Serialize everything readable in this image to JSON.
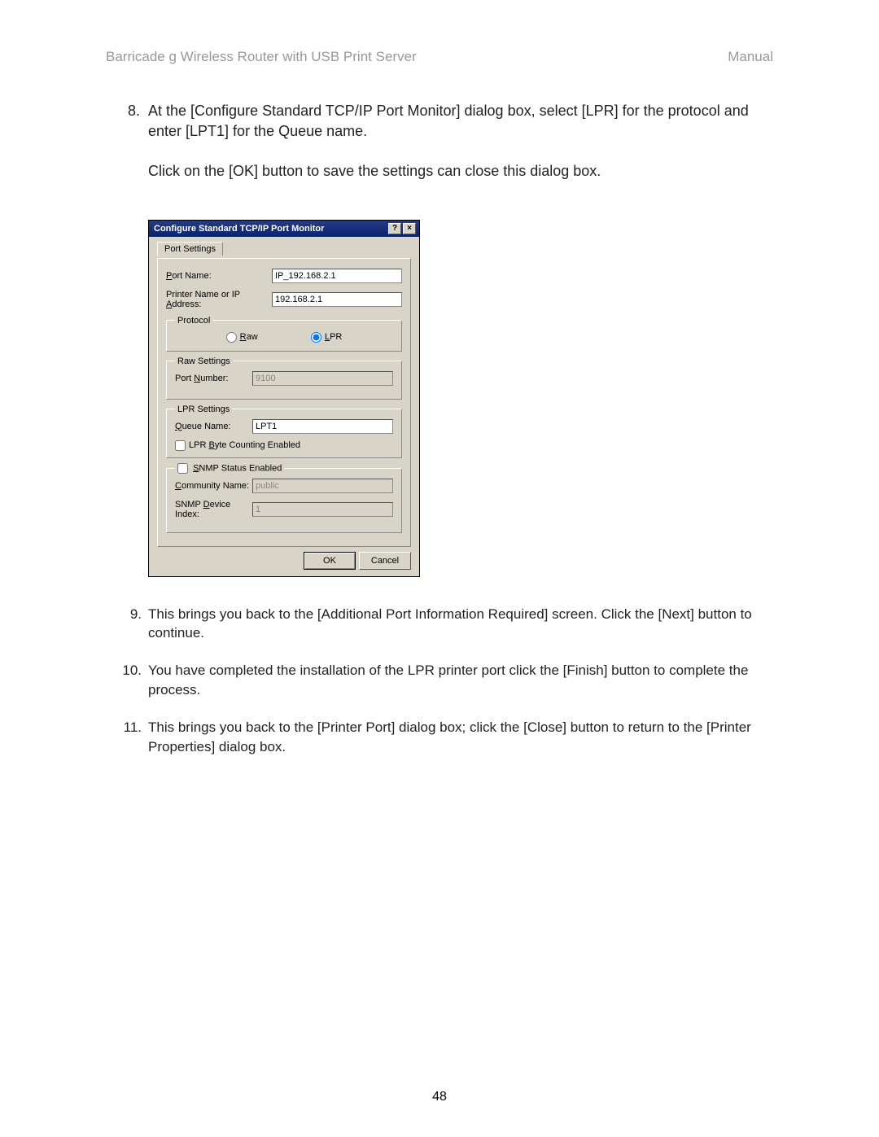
{
  "header": {
    "left": "Barricade g Wireless Router with USB Print Server",
    "right": "Manual"
  },
  "step8": {
    "num": "8.",
    "para1": "At the [Configure Standard TCP/IP Port Monitor] dialog box, select [LPR] for the protocol and enter [LPT1] for the Queue name.",
    "para2": "Click on the [OK] button to save the settings can close this dialog box."
  },
  "dialog": {
    "title": "Configure Standard TCP/IP Port Monitor",
    "tab": "Port Settings",
    "portName": {
      "label_pre": "P",
      "label_post": "ort Name:",
      "value": "IP_192.168.2.1"
    },
    "ipAddr": {
      "label_pre": "Printer Name or IP ",
      "label_mid": "A",
      "label_post": "ddress:",
      "value": "192.168.2.1"
    },
    "protocol": {
      "legend": "Protocol",
      "raw_pre": "R",
      "raw_post": "aw",
      "lpr_pre": "L",
      "lpr_post": "PR"
    },
    "rawSettings": {
      "legend": "Raw Settings",
      "portnum_pre": "Port ",
      "portnum_mid": "N",
      "portnum_post": "umber:",
      "value": "9100"
    },
    "lprSettings": {
      "legend": "LPR Settings",
      "queue_pre": "Q",
      "queue_post": "ueue Name:",
      "queue_value": "LPT1",
      "byte_pre": "LPR ",
      "byte_mid": "B",
      "byte_post": "yte Counting Enabled"
    },
    "snmp": {
      "legend_pre": "S",
      "legend_post": "NMP Status Enabled",
      "comm_pre": "C",
      "comm_post": "ommunity Name:",
      "comm_value": "public",
      "idx_pre": "SNMP ",
      "idx_mid": "D",
      "idx_post": "evice Index:",
      "idx_value": "1"
    },
    "buttons": {
      "ok": "OK",
      "cancel": "Cancel"
    }
  },
  "steps_below": [
    {
      "n": "9.",
      "t": "This brings you back to the [Additional Port Information Required] screen.  Click the [Next] button to continue."
    },
    {
      "n": "10.",
      "t": "You have completed the installation of the LPR printer port click the [Finish] button to complete the process."
    },
    {
      "n": "11.",
      "t": "This brings you back to the [Printer Port] dialog box; click the [Close] button to return to the [Printer Properties] dialog box."
    }
  ],
  "pageNumber": "48"
}
